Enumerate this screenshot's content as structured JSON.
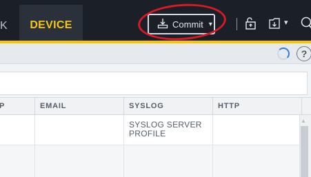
{
  "nav": {
    "partial_tab_label": "K",
    "active_tab_label": "DEVICE",
    "commit_label": "Commit",
    "icons": [
      "commit-download-icon",
      "lock-icon",
      "config-save-icon",
      "chevron-down-icon",
      "search-icon"
    ]
  },
  "toolbar": {
    "help_label": "?"
  },
  "table": {
    "columns": [
      "P",
      "EMAIL",
      "SYSLOG",
      "HTTP"
    ],
    "rows": [
      {
        "p": "",
        "email": "",
        "syslog_line1": "SYSLOG SERVER",
        "syslog_line2": "PROFILE",
        "http": ""
      },
      {
        "p": "",
        "email": "",
        "syslog_line1": "",
        "syslog_line2": "",
        "http": ""
      }
    ]
  },
  "colors": {
    "nav_bg": "#1b2028",
    "accent": "#f7c600",
    "active_tab_text": "#f5c518",
    "annotation_ring": "#d51b23",
    "spinner": "#2f7fd9"
  }
}
